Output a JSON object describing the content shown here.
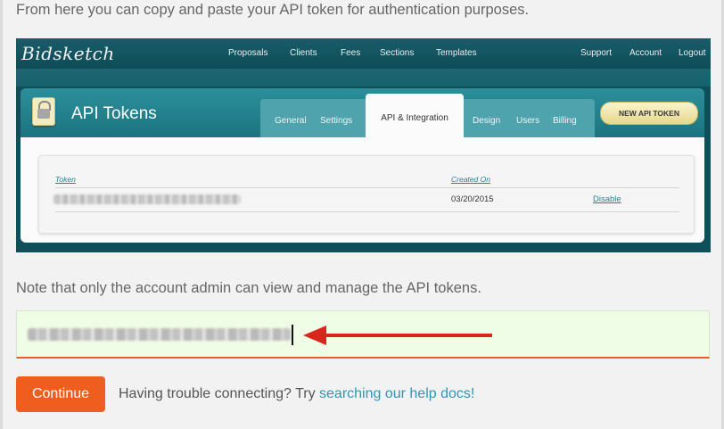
{
  "intro_text": "From here you can copy and paste your API token for authentication purposes.",
  "embedded_app": {
    "logo": "Bidsketch",
    "nav": [
      "Proposals",
      "Clients",
      "Fees",
      "Sections",
      "Templates"
    ],
    "nav_right": [
      "Support",
      "Account",
      "Logout"
    ],
    "page_title": "API Tokens",
    "lock_icon": "lock-icon",
    "tabs": [
      "General",
      "Settings",
      "API & Integration",
      "Design",
      "Users",
      "Billing"
    ],
    "active_tab": "API & Integration",
    "new_token_button": "NEW API TOKEN",
    "table": {
      "headers": {
        "token": "Token",
        "created_on": "Created On"
      },
      "rows": [
        {
          "created_on": "03/20/2015",
          "action": "Disable"
        }
      ]
    }
  },
  "note_text": "Note that only the account admin can view and manage the API tokens.",
  "token_input": {
    "accent_color": "#ea5d26",
    "arrow_color": "#d9261c"
  },
  "continue_button": "Continue",
  "trouble_text": "Having trouble connecting? Try ",
  "help_link": "searching our help docs!"
}
